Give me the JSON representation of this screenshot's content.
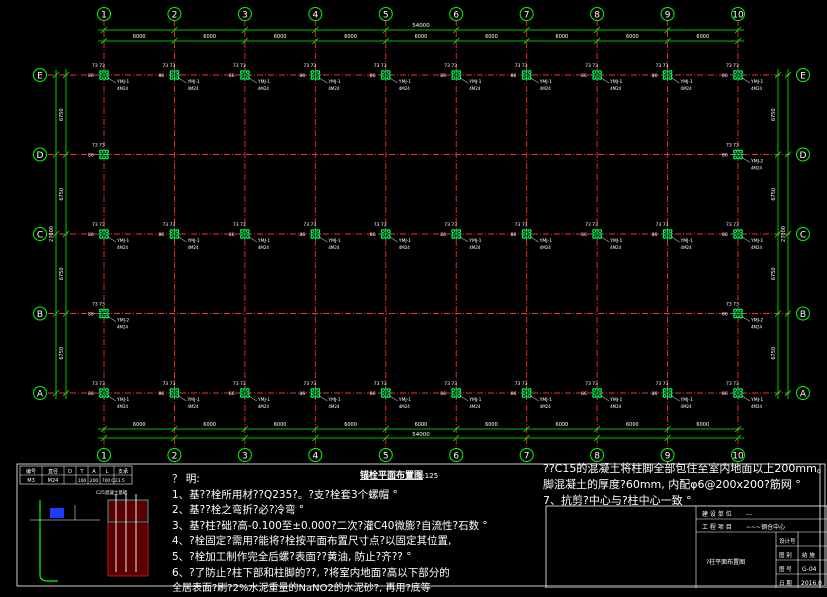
{
  "drawing": {
    "total_length": "54000",
    "col_labels": [
      "1",
      "2",
      "3",
      "4",
      "5",
      "6",
      "7",
      "8",
      "9",
      "10"
    ],
    "row_labels": [
      "E",
      "D",
      "C",
      "B",
      "A"
    ],
    "bay_spacing": "6000",
    "row_spacing_left": [
      "6750",
      "6750",
      "6750",
      "6750"
    ],
    "row_total_left": "27000",
    "row_spacing_right": [
      "6750",
      "6750",
      "6750",
      "6750"
    ],
    "row_total_right": "27000",
    "dim_73": "73",
    "bolt_code": "YMJ-1",
    "bolt_code_2": "YMJ-2",
    "bolt_spec": "4M24",
    "bolt_offset": "86"
  },
  "plan_title": "锚栓平面布置图",
  "plan_scale": "1:125",
  "notes_heading": "？ 明:",
  "notes": [
    "1、基??栓所用材??Q235?。?支?栓套3个螺帽 °",
    "2、基??栓之弯折?必?冷弯 °",
    "3、基?柱?础?高-0.100至±0.000?二次?灌C40微膨?自流性?石数 °",
    "4、?栓固定?需用?能将?栓按平面布置尺寸点?以固定其位置,",
    "5、?栓加工制作完全后螺?表面??黄油, 防止?齐?? °",
    "6、?了防止?柱下部和柱脚的??, ?将室内地面?高以下部分的",
    "    全居表面?刷?2%水泥重量的NaNO2的水泥砂?, 再用?底等"
  ],
  "notes_right": [
    "??C15的混凝土将柱脚全部包住至室内地面以上200mm。包",
    "脚混凝土的厚度?60mm, 内配φ6@200x200?筋网 °",
    "7、抗剪?中心与?柱中心一致 °"
  ],
  "bolt_table": {
    "header": [
      "编号",
      "直径",
      "D",
      "T",
      "A",
      "L",
      "支承"
    ],
    "row": [
      "M3",
      "M24",
      "",
      "",
      "",
      "",
      "",
      ""
    ],
    "row2": [
      "",
      "",
      "100",
      "200",
      "700",
      "Q23.5"
    ],
    "sublabel": "C25混凝土基础"
  },
  "title_block": {
    "project_label": "建 设 单 位",
    "project_value": "---",
    "work_label": "工 程 项 目",
    "work_value": "~~~钢仓中心",
    "drawing_name": "?柱平面布置图",
    "design_no_label": "设计号",
    "stage_label": "图 别",
    "stage_value": "结 施",
    "sheet_label": "图 号",
    "sheet_value": "G-04",
    "date_label": "日 期",
    "date_value": "2016.0"
  },
  "colors": {
    "axis": "#ff2a2a",
    "dim": "#00ff00",
    "bubble": "#00ff00",
    "bolt": "#00ff60",
    "text": "#ffffff",
    "frame": "#ffffff"
  }
}
